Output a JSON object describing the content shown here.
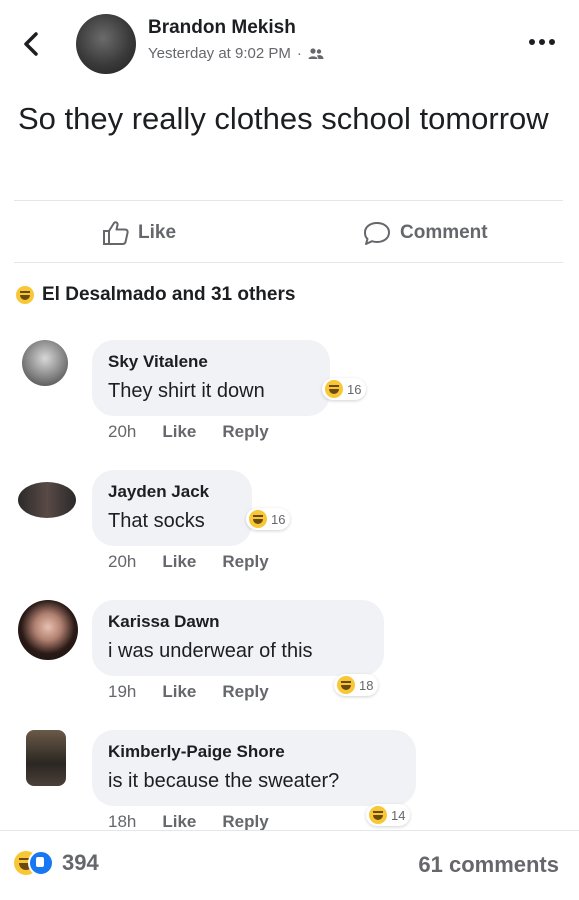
{
  "post": {
    "author": "Brandon Mekish",
    "timestamp": "Yesterday at 9:02 PM",
    "separator": "·",
    "audience_icon": "friends-icon",
    "text": "So they really clothes school tomorrow"
  },
  "actions": {
    "like_label": "Like",
    "comment_label": "Comment"
  },
  "reactions": {
    "summary": "El Desalmado and 31 others",
    "icon": "haha-icon"
  },
  "comments": [
    {
      "name": "Sky Vitalene",
      "text": "They shirt it down",
      "time": "20h",
      "like": "Like",
      "reply": "Reply",
      "reaction_count": "16"
    },
    {
      "name": "Jayden Jack",
      "text": "That socks",
      "time": "20h",
      "like": "Like",
      "reply": "Reply",
      "reaction_count": "16"
    },
    {
      "name": "Karissa Dawn",
      "text": "i was underwear of this",
      "time": "19h",
      "like": "Like",
      "reply": "Reply",
      "reaction_count": "18"
    },
    {
      "name": "Kimberly-Paige Shore",
      "text": "is it because the sweater?",
      "time": "18h",
      "like": "Like",
      "reply": "Reply",
      "reaction_count": "14"
    }
  ],
  "footer": {
    "reaction_total": "394",
    "comments_total": "61 comments"
  },
  "colors": {
    "text": "#1c1e21",
    "secondary": "#65676b",
    "bubble": "#f0f2f5",
    "haha": "#f7c736",
    "like_blue": "#1877f2"
  }
}
